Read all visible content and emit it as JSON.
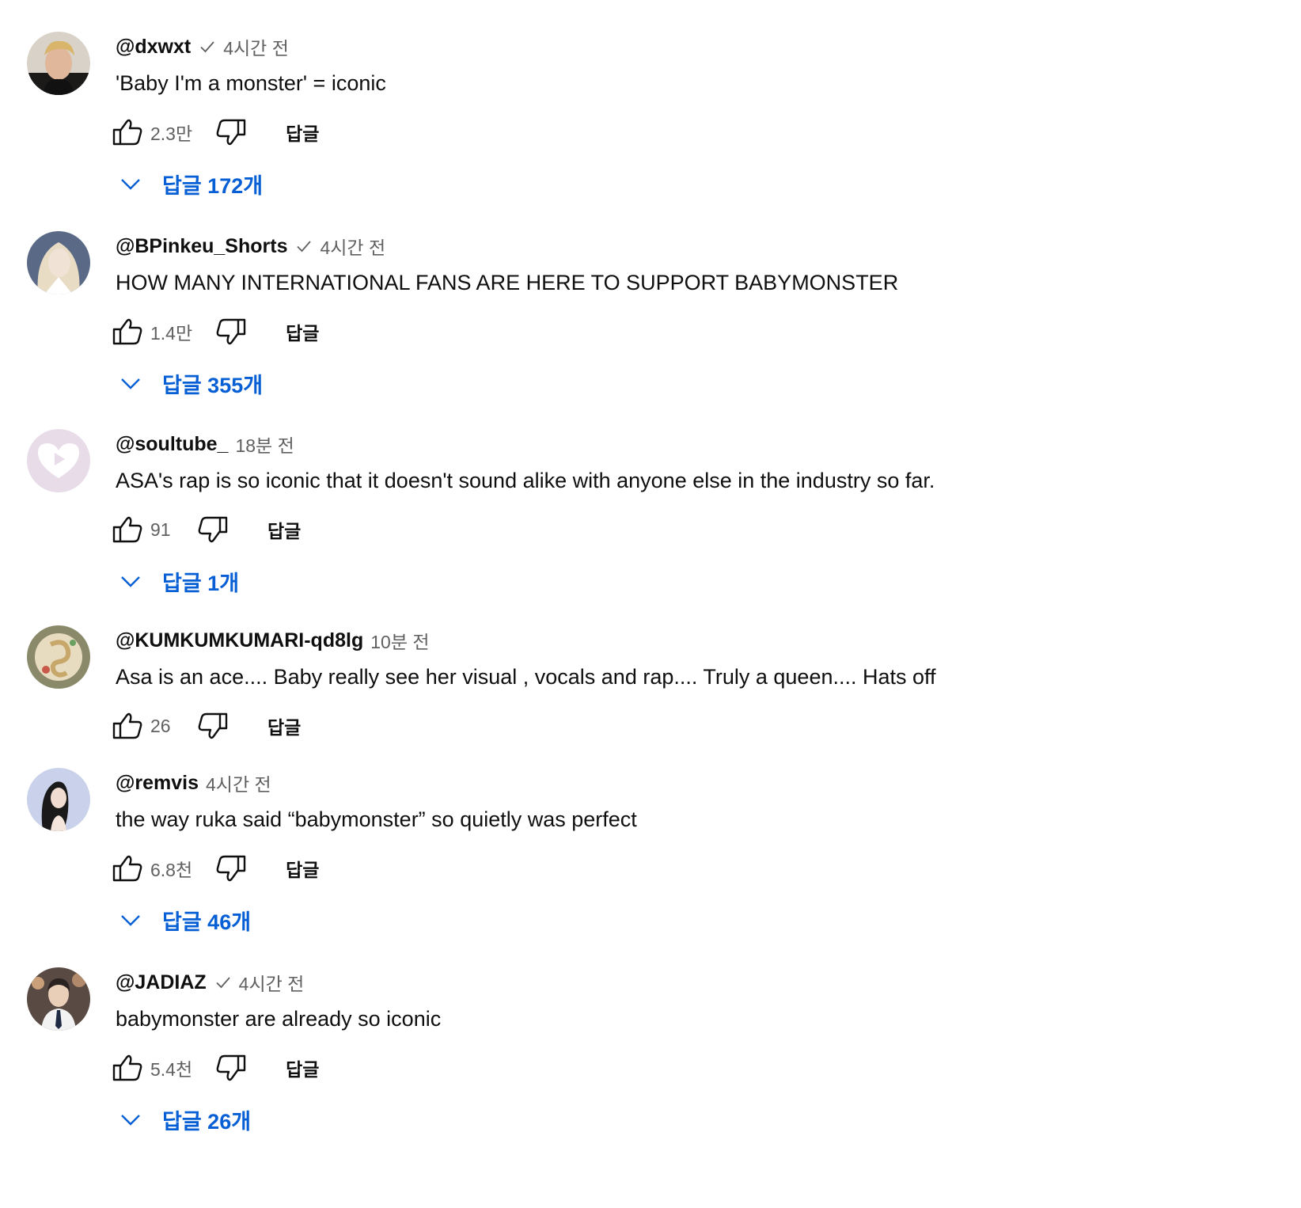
{
  "colors": {
    "text_primary": "#0f0f0f",
    "text_secondary": "#606060",
    "link_blue": "#065fd4"
  },
  "comments": [
    {
      "author": "@dxwxt",
      "verified": true,
      "time": "4시간 전",
      "text": "'Baby I'm a monster' = iconic",
      "likes": "2.3만",
      "reply_label": "답글",
      "replies_label": "답글 172개",
      "avatar_icon": "avatar-photo-icon"
    },
    {
      "author": "@BPinkeu_Shorts",
      "verified": true,
      "time": "4시간 전",
      "text": "HOW MANY INTERNATIONAL FANS ARE HERE TO SUPPORT BABYMONSTER",
      "likes": "1.4만",
      "reply_label": "답글",
      "replies_label": "답글 355개",
      "avatar_icon": "avatar-photo-icon"
    },
    {
      "author": "@soultube_",
      "verified": false,
      "time": "18분 전",
      "text": "ASA's rap is so iconic that it doesn't sound alike with anyone else in the industry so far.",
      "likes": "91",
      "reply_label": "답글",
      "replies_label": "답글 1개",
      "avatar_icon": "heart-play-icon"
    },
    {
      "author": "@KUMKUMKUMARI-qd8lg",
      "verified": false,
      "time": "10분 전",
      "text": "Asa is an ace.... Baby really see her visual , vocals and rap.... Truly a queen.... Hats off",
      "likes": "26",
      "reply_label": "답글",
      "replies_label": null,
      "avatar_icon": "avatar-photo-icon"
    },
    {
      "author": "@remvis",
      "verified": false,
      "time": "4시간 전",
      "text": "the way ruka said “babymonster” so quietly was perfect",
      "likes": "6.8천",
      "reply_label": "답글",
      "replies_label": "답글 46개",
      "avatar_icon": "avatar-photo-icon"
    },
    {
      "author": "@JADIAZ",
      "verified": true,
      "time": "4시간 전",
      "text": "babymonster are already so iconic",
      "likes": "5.4천",
      "reply_label": "답글",
      "replies_label": "답글 26개",
      "avatar_icon": "avatar-photo-icon"
    }
  ]
}
